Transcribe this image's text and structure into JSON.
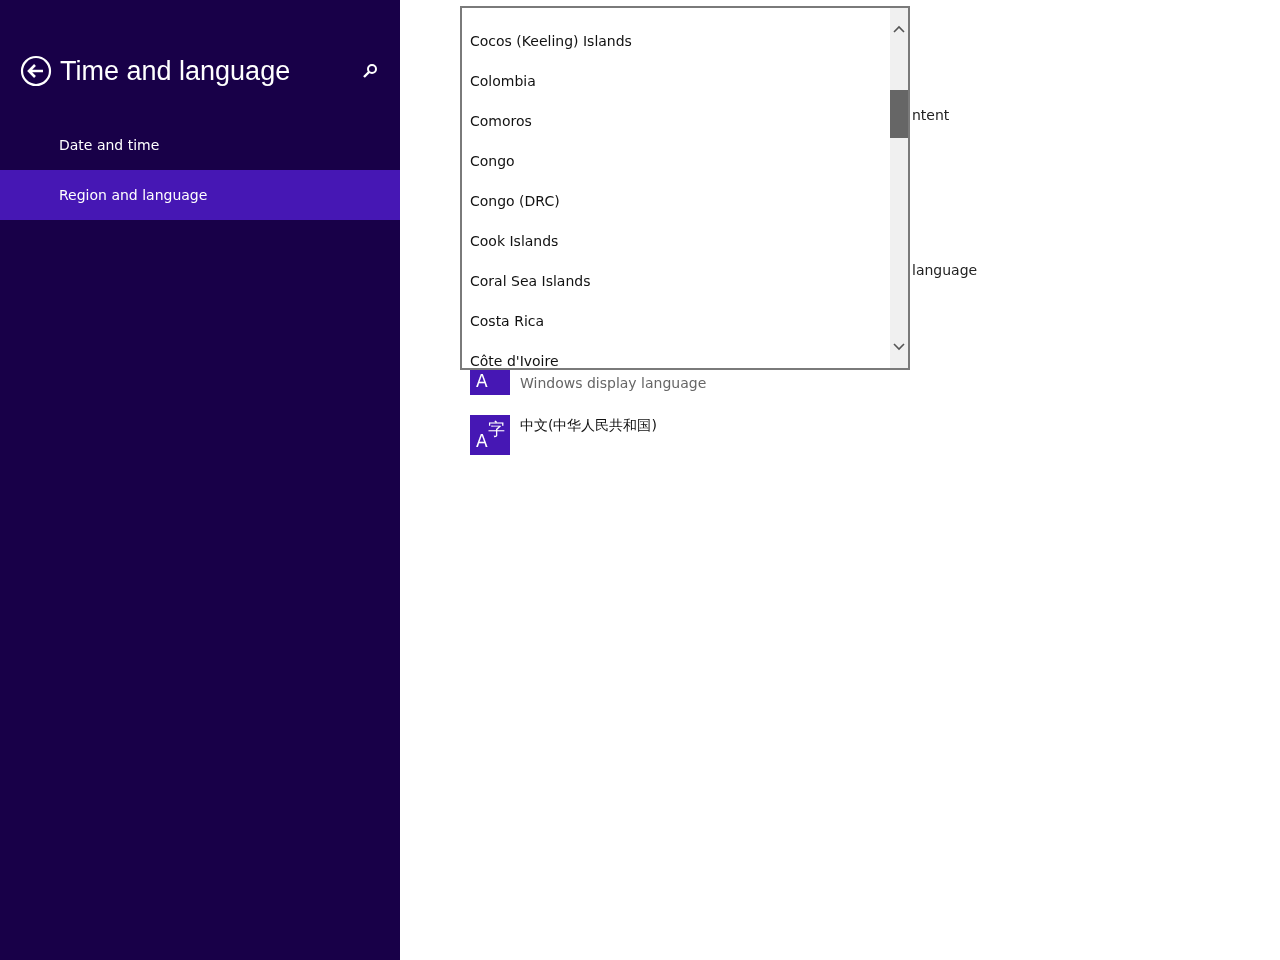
{
  "sidebar": {
    "title": "Time and language",
    "items": [
      {
        "label": "Date and time",
        "selected": false
      },
      {
        "label": "Region and language",
        "selected": true
      }
    ]
  },
  "background_texts": [
    "ntent",
    "language"
  ],
  "languages": [
    {
      "icon_letter": "A",
      "detail": "Windows display language"
    },
    {
      "icon_letter": "A",
      "icon_char": "字",
      "name": "中文(中华人民共和国)"
    }
  ],
  "dropdown": {
    "options": [
      "Cocos (Keeling) Islands",
      "Colombia",
      "Comoros",
      "Congo",
      "Congo (DRC)",
      "Cook Islands",
      "Coral Sea Islands",
      "Costa Rica",
      "Côte d'Ivoire"
    ]
  }
}
